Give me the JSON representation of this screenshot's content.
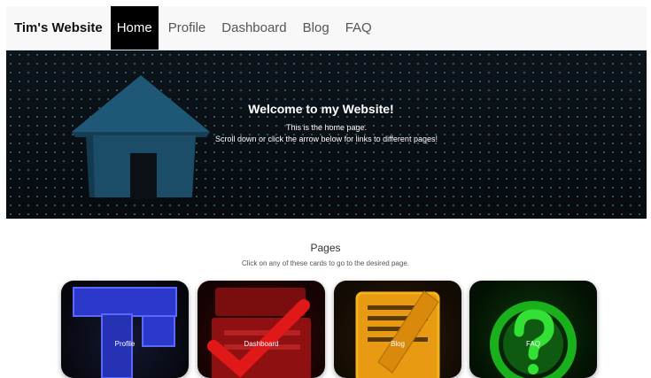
{
  "navbar": {
    "brand": "Tim's Website",
    "items": [
      {
        "label": "Home",
        "active": true
      },
      {
        "label": "Profile",
        "active": false
      },
      {
        "label": "Dashboard",
        "active": false
      },
      {
        "label": "Blog",
        "active": false
      },
      {
        "label": "FAQ",
        "active": false
      }
    ]
  },
  "hero": {
    "title": "Welcome to my Website!",
    "line1": "This is the home page.",
    "line2": "Scroll down or click the arrow below for links to different pages!",
    "icon": "house-icon"
  },
  "pages": {
    "title": "Pages",
    "subtitle": "Click on any of these cards to go to the desired page.",
    "cards": [
      {
        "label": "Profile",
        "icon": "profile-blocks-icon"
      },
      {
        "label": "Dashboard",
        "icon": "checklist-icon"
      },
      {
        "label": "Blog",
        "icon": "notepad-pencil-icon"
      },
      {
        "label": "FAQ",
        "icon": "question-mark-icon"
      }
    ]
  },
  "colors": {
    "nav_active_bg": "#000000",
    "hero_bg": "#0a1016",
    "house": "#1f5a78"
  }
}
